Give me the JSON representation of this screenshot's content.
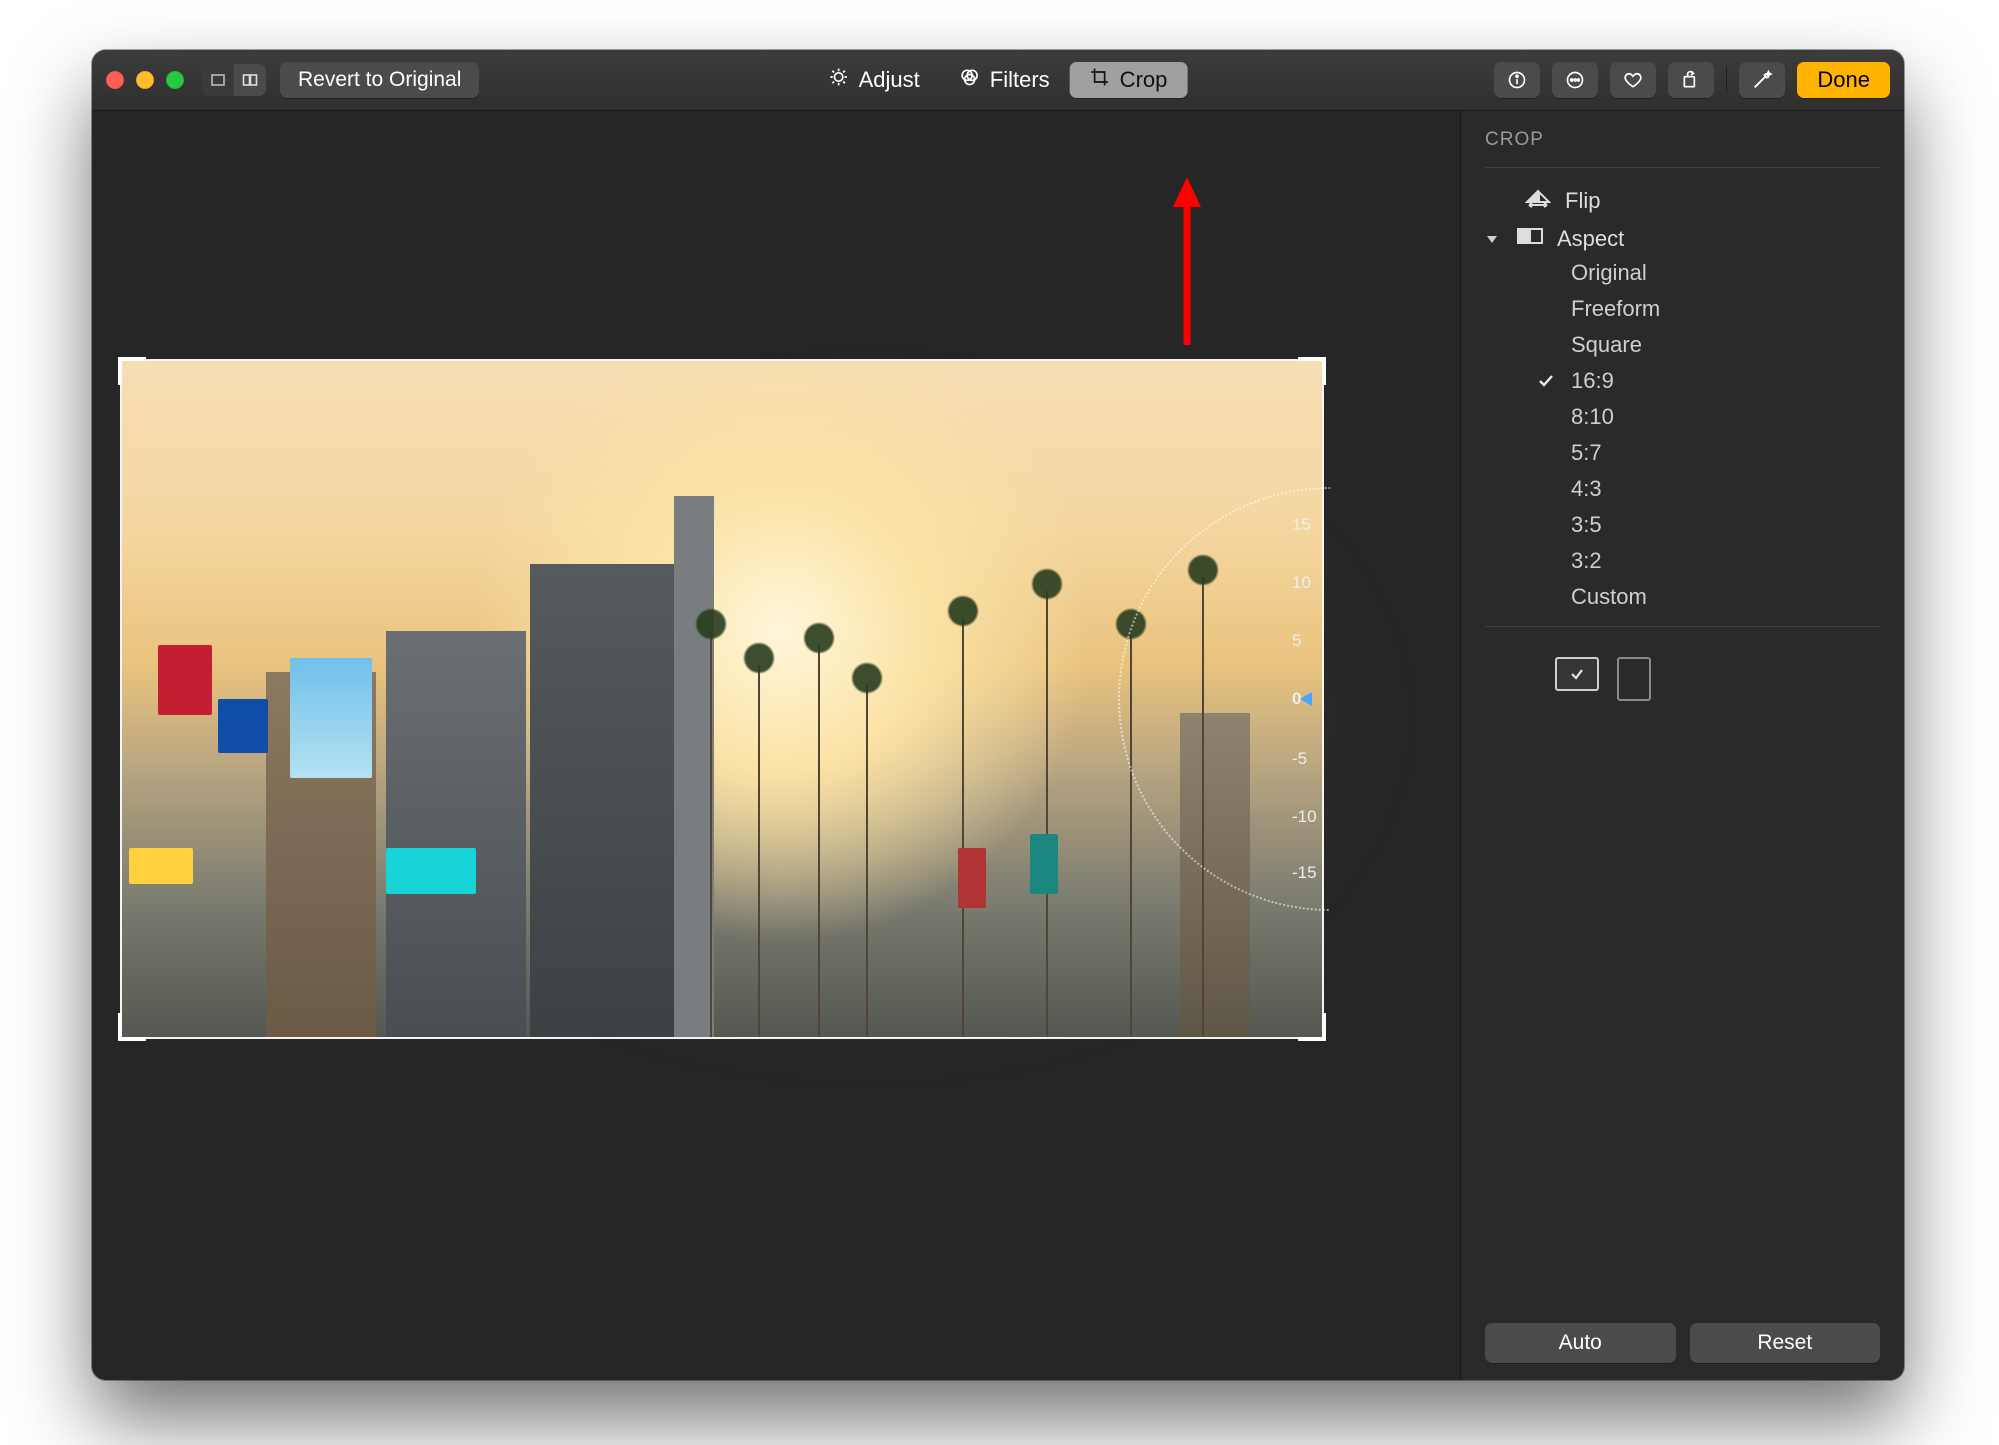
{
  "toolbar": {
    "revert_label": "Revert to Original",
    "done_label": "Done",
    "tabs": {
      "adjust": "Adjust",
      "filters": "Filters",
      "crop": "Crop"
    }
  },
  "sidebar": {
    "title": "CROP",
    "flip_label": "Flip",
    "aspect_label": "Aspect",
    "aspect_options": {
      "original": "Original",
      "freeform": "Freeform",
      "square": "Square",
      "r16_9": "16:9",
      "r8_10": "8:10",
      "r5_7": "5:7",
      "r4_3": "4:3",
      "r3_5": "3:5",
      "r3_2": "3:2",
      "custom": "Custom"
    },
    "selected_aspect": "r16_9",
    "auto_label": "Auto",
    "reset_label": "Reset"
  },
  "wheel": {
    "value": "0",
    "p5": "5",
    "p10": "10",
    "p15": "15",
    "m5": "-5",
    "m10": "-10",
    "m15": "-15"
  }
}
